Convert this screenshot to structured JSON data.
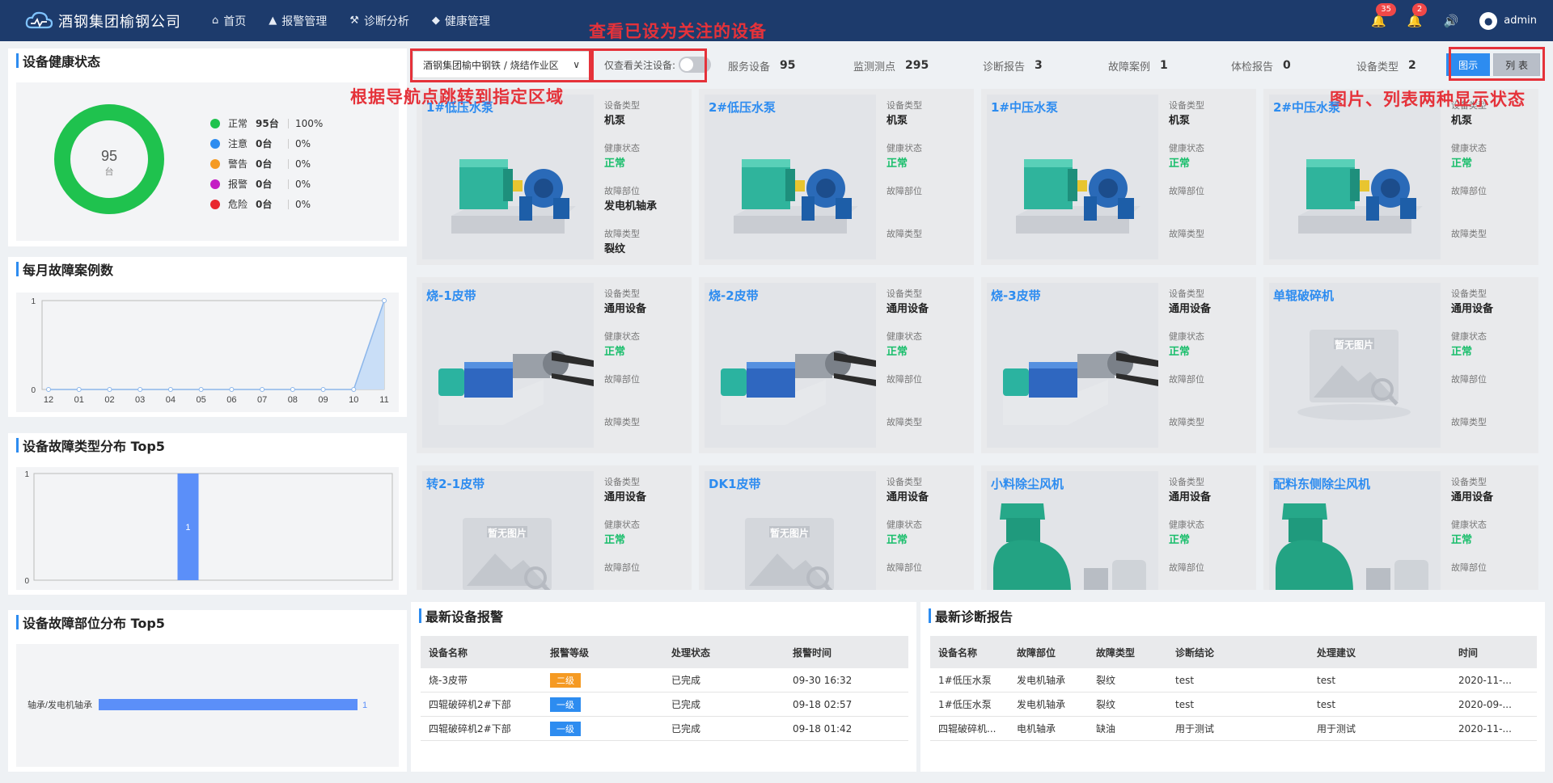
{
  "header": {
    "brand": "酒钢集团榆钢公司",
    "nav": [
      {
        "label": "首页",
        "icon": "home-icon"
      },
      {
        "label": "报警管理",
        "icon": "alarm-icon"
      },
      {
        "label": "诊断分析",
        "icon": "wrench-icon"
      },
      {
        "label": "健康管理",
        "icon": "shield-icon"
      }
    ],
    "alarm_badge": "35",
    "notice_badge": "2",
    "user": "admin"
  },
  "health": {
    "title": "设备健康状态",
    "total": "95",
    "unit": "台",
    "legend": [
      {
        "name": "正常",
        "count": "95台",
        "pct": "100%",
        "color": "#1fc24e"
      },
      {
        "name": "注意",
        "count": "0台",
        "pct": "0%",
        "color": "#2d8cf0"
      },
      {
        "name": "警告",
        "count": "0台",
        "pct": "0%",
        "color": "#f59a23"
      },
      {
        "name": "报警",
        "count": "0台",
        "pct": "0%",
        "color": "#c41cc4"
      },
      {
        "name": "危险",
        "count": "0台",
        "pct": "0%",
        "color": "#e8282e"
      }
    ]
  },
  "monthly": {
    "title": "每月故障案例数"
  },
  "fault_type": {
    "title": "设备故障类型分布 Top5"
  },
  "fault_part": {
    "title": "设备故障部位分布 Top5"
  },
  "chart_data": [
    {
      "type": "area",
      "title": "每月故障案例数",
      "categories": [
        "12",
        "01",
        "02",
        "03",
        "04",
        "05",
        "06",
        "07",
        "08",
        "09",
        "10",
        "11"
      ],
      "values": [
        0,
        0,
        0,
        0,
        0,
        0,
        0,
        0,
        0,
        0,
        0,
        1
      ],
      "ylim": [
        0,
        1
      ],
      "yticks": [
        "0",
        "1"
      ]
    },
    {
      "type": "bar",
      "title": "设备故障类型分布 Top5",
      "categories": [
        ""
      ],
      "values": [
        1
      ],
      "ylim": [
        0,
        1
      ],
      "yticks": [
        "0",
        "1"
      ],
      "data_labels": [
        "1"
      ]
    },
    {
      "type": "bar",
      "title": "设备故障部位分布 Top5",
      "orientation": "horizontal",
      "categories": [
        "轴承/发电机轴承"
      ],
      "values": [
        1
      ],
      "data_labels": [
        "1"
      ]
    }
  ],
  "filter": {
    "location": "酒钢集团榆中钢铁 / 烧结作业区",
    "follow_label": "仅查看关注设备:",
    "stats": [
      {
        "label": "服务设备",
        "value": "95"
      },
      {
        "label": "监测测点",
        "value": "295"
      },
      {
        "label": "诊断报告",
        "value": "3"
      },
      {
        "label": "故障案例",
        "value": "1"
      },
      {
        "label": "体检报告",
        "value": "0"
      },
      {
        "label": "设备类型",
        "value": "2"
      }
    ],
    "view_image": "图示",
    "view_list": "列 表"
  },
  "annotations": {
    "follow": "查看已设为关注的设备",
    "nav": "根据导航点跳转到指定区域",
    "views": "图片、列表两种显示状态"
  },
  "labels": {
    "type": "设备类型",
    "health": "健康状态",
    "part": "故障部位",
    "fault": "故障类型",
    "noimg": "暂无图片"
  },
  "devices": [
    {
      "name": "1#低压水泵",
      "type": "机泵",
      "health": "正常",
      "part": "发电机轴承",
      "fault": "裂纹",
      "img": "pump"
    },
    {
      "name": "2#低压水泵",
      "type": "机泵",
      "health": "正常",
      "part": "",
      "fault": "",
      "img": "pump"
    },
    {
      "name": "1#中压水泵",
      "type": "机泵",
      "health": "正常",
      "part": "",
      "fault": "",
      "img": "pump"
    },
    {
      "name": "2#中压水泵",
      "type": "机泵",
      "health": "正常",
      "part": "",
      "fault": "",
      "img": "pump"
    },
    {
      "name": "烧-1皮带",
      "type": "通用设备",
      "health": "正常",
      "part": "",
      "fault": "",
      "img": "belt"
    },
    {
      "name": "烧-2皮带",
      "type": "通用设备",
      "health": "正常",
      "part": "",
      "fault": "",
      "img": "belt"
    },
    {
      "name": "烧-3皮带",
      "type": "通用设备",
      "health": "正常",
      "part": "",
      "fault": "",
      "img": "belt"
    },
    {
      "name": "单辊破碎机",
      "type": "通用设备",
      "health": "正常",
      "part": "",
      "fault": "",
      "img": "none"
    },
    {
      "name": "转2-1皮带",
      "type": "通用设备",
      "health": "正常",
      "part": "",
      "fault": "",
      "img": "none"
    },
    {
      "name": "DK1皮带",
      "type": "通用设备",
      "health": "正常",
      "part": "",
      "fault": "",
      "img": "none"
    },
    {
      "name": "小料除尘风机",
      "type": "通用设备",
      "health": "正常",
      "part": "",
      "fault": "",
      "img": "fan"
    },
    {
      "name": "配料东侧除尘风机",
      "type": "通用设备",
      "health": "正常",
      "part": "",
      "fault": "",
      "img": "fan"
    }
  ],
  "alarms": {
    "title": "最新设备报警",
    "headers": [
      "设备名称",
      "报警等级",
      "处理状态",
      "报警时间"
    ],
    "rows": [
      {
        "name": "烧-3皮带",
        "level": "二级",
        "lv": "l2",
        "status": "已完成",
        "time": "09-30 16:32"
      },
      {
        "name": "四辊破碎机2#下部",
        "level": "一级",
        "lv": "l1",
        "status": "已完成",
        "time": "09-18 02:57"
      },
      {
        "name": "四辊破碎机2#下部",
        "level": "一级",
        "lv": "l1",
        "status": "已完成",
        "time": "09-18 01:42"
      }
    ]
  },
  "reports": {
    "title": "最新诊断报告",
    "headers": [
      "设备名称",
      "故障部位",
      "故障类型",
      "诊断结论",
      "处理建议",
      "时间"
    ],
    "rows": [
      [
        "1#低压水泵",
        "发电机轴承",
        "裂纹",
        "test",
        "test",
        "2020-11-..."
      ],
      [
        "1#低压水泵",
        "发电机轴承",
        "裂纹",
        "test",
        "test",
        "2020-09-..."
      ],
      [
        "四辊破碎机...",
        "电机轴承",
        "缺油",
        "用于测试",
        "用于测试",
        "2020-11-..."
      ]
    ]
  }
}
